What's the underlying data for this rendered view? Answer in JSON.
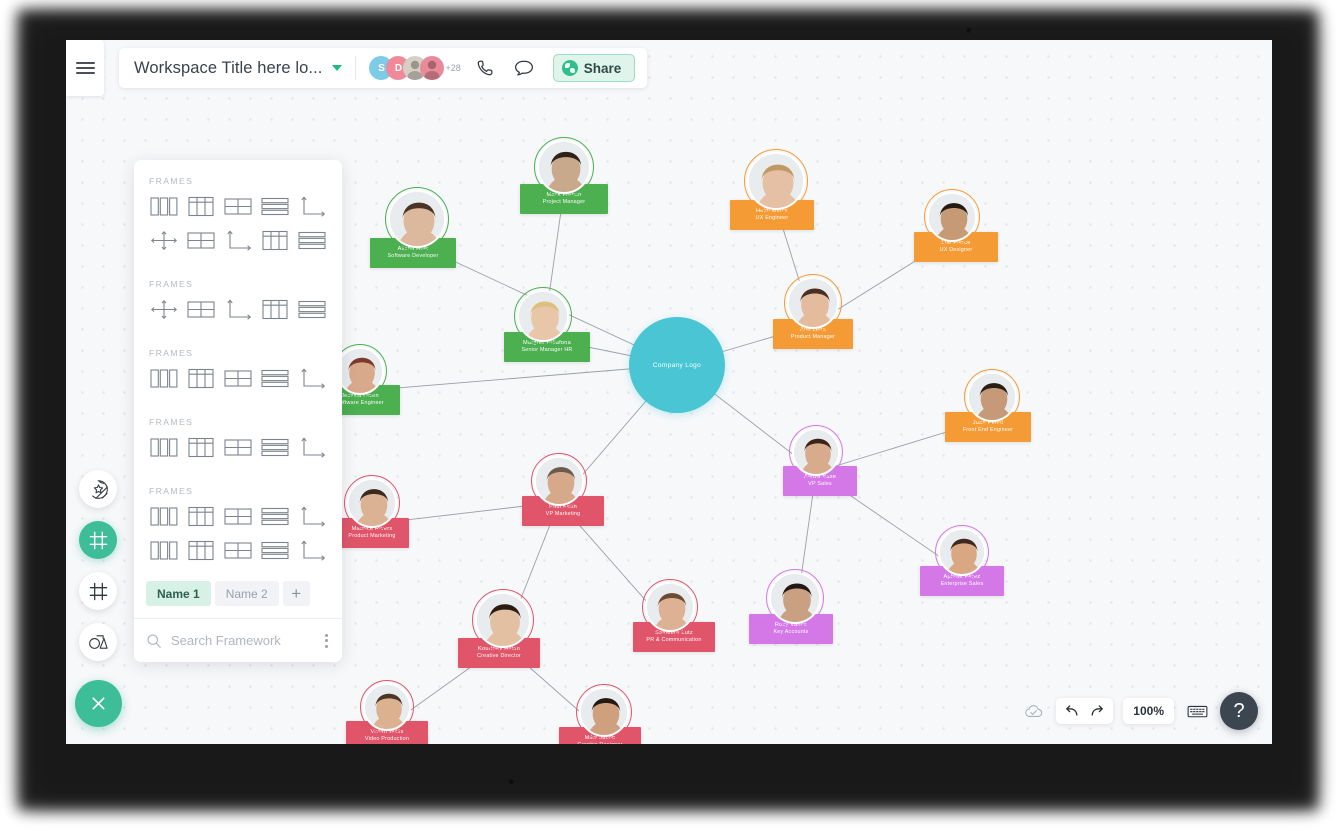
{
  "topbar": {
    "menu_icon": "hamburger-menu-icon",
    "workspace_title": "Workspace Title here lo...",
    "dropdown_icon": "chevron-down-icon",
    "avatars": [
      {
        "label": "S",
        "color": "#7ecbe8",
        "type": "initial"
      },
      {
        "label": "D",
        "color": "#f08a9b",
        "type": "initial"
      },
      {
        "label": "",
        "color": "#d6cfc4",
        "type": "photo"
      },
      {
        "label": "",
        "color": "#e88a9a",
        "type": "photo"
      }
    ],
    "avatar_overflow": "+28",
    "call_icon": "phone-icon",
    "chat_icon": "chat-bubble-icon",
    "share_label": "Share",
    "share_icon": "globe-icon",
    "share_bg": "#dff5ec",
    "share_text_color": "#2f4a48"
  },
  "left_toolbar": [
    {
      "name": "sticker-tool",
      "icon": "sticker-star-icon",
      "active": false
    },
    {
      "name": "frames-tool",
      "icon": "frame-grid-icon",
      "active": true
    },
    {
      "name": "grid-tool",
      "icon": "frame-outline-icon",
      "active": false
    },
    {
      "name": "shapes-tool",
      "icon": "shapes-icon",
      "active": false
    },
    {
      "name": "close-tool",
      "icon": "close-x-icon",
      "active": true
    }
  ],
  "frames_panel": {
    "groups": [
      {
        "label": "FRAMES",
        "rows": [
          [
            "columns-3",
            "grid-header-3col",
            "quad-2x2",
            "stacked-bars",
            "axis-l"
          ],
          [
            "cross-arrows",
            "quad-2x2",
            "axis-l",
            "grid-header-3col",
            "stacked-bars"
          ]
        ]
      },
      {
        "label": "FRAMES",
        "rows": [
          [
            "cross-arrows",
            "quad-2x2",
            "axis-l",
            "grid-header-3col",
            "stacked-bars"
          ]
        ]
      },
      {
        "label": "FRAMES",
        "rows": [
          [
            "columns-3",
            "grid-header-3col",
            "quad-2x2",
            "stacked-bars",
            "axis-l"
          ]
        ]
      },
      {
        "label": "FRAMES",
        "rows": [
          [
            "columns-3",
            "grid-header-3col",
            "quad-2x2",
            "stacked-bars",
            "axis-l"
          ]
        ]
      },
      {
        "label": "FRAMES",
        "rows": [
          [
            "columns-3",
            "grid-header-3col",
            "quad-2x2",
            "stacked-bars",
            "axis-l"
          ],
          [
            "columns-3",
            "grid-header-3col",
            "quad-2x2",
            "stacked-bars",
            "axis-l"
          ]
        ]
      }
    ],
    "tabs": [
      {
        "label": "Name 1",
        "active": true
      },
      {
        "label": "Name 2",
        "active": false
      }
    ],
    "add_tab_label": "+",
    "search_placeholder": "Search Framework",
    "search_icon": "search-icon",
    "more_icon": "more-vertical-icon"
  },
  "chart": {
    "center": {
      "label": "Company   Logo",
      "color": "#49c5d4"
    },
    "colors": {
      "green": "#4caf50",
      "orange": "#f59b35",
      "red": "#e0556a",
      "purple": "#d478e8"
    },
    "nodes": [
      {
        "name": "Mack   French",
        "role": "Project   Manager",
        "color": "green",
        "skin": "#c9a98c",
        "hair": "#2e2118"
      },
      {
        "name": "Alisha   Holk",
        "role": "Software   Developer",
        "color": "green",
        "skin": "#dcb89c",
        "hair": "#4a3426"
      },
      {
        "name": "Margret   Yuliafona",
        "role": "Senior   Manager   HR",
        "color": "green",
        "skin": "#e8c6a8",
        "hair": "#ddc07e"
      },
      {
        "name": "Jessica   Owen",
        "role": "Software   Engineer",
        "color": "green",
        "skin": "#d9a98b",
        "hair": "#7a3b2c"
      },
      {
        "name": "Heidi   Mince",
        "role": "UX   Engineer",
        "color": "orange",
        "skin": "#e6c0a4",
        "hair": "#c09a63"
      },
      {
        "name": "Lue   Pierce",
        "role": "UX   Designer",
        "color": "orange",
        "skin": "#c59a74",
        "hair": "#231a14"
      },
      {
        "name": "Ann   Leda",
        "role": "Product   Manager",
        "color": "orange",
        "skin": "#e5bb9d",
        "hair": "#4b2f20"
      },
      {
        "name": "Juan   Pedid",
        "role": "Front   End   Engineer",
        "color": "orange",
        "skin": "#c69a78",
        "hair": "#2a1d16"
      },
      {
        "name": "Aaliya   Base",
        "role": "VP   Sales",
        "color": "purple",
        "skin": "#d8ab8d",
        "hair": "#3a2418"
      },
      {
        "name": "Aphtae   Perez",
        "role": "Enterprise   Sales",
        "color": "purple",
        "skin": "#d9a883",
        "hair": "#3d2a1c"
      },
      {
        "name": "Roxy   Vance",
        "role": "Key   Accounts",
        "color": "purple",
        "skin": "#caa083",
        "hair": "#241912"
      },
      {
        "name": "Paul   Keith",
        "role": "VP   Marketing",
        "color": "red",
        "skin": "#d7a98b",
        "hair": "#6b5a4d"
      },
      {
        "name": "Maurice   Rivers",
        "role": "Product   Marketing",
        "color": "red",
        "skin": "#dbb294",
        "hair": "#3b2b1e"
      },
      {
        "name": "Kourtney   Hilton",
        "role": "Creative   Director",
        "color": "red",
        "skin": "#e3c0a2",
        "hair": "#2c1d14"
      },
      {
        "name": "Sameera   Lutz",
        "role": "PR   &   Communication",
        "color": "red",
        "skin": "#ddb294",
        "hair": "#6d4b33"
      },
      {
        "name": "Vivian   Willis",
        "role": "Video   Production",
        "color": "red",
        "skin": "#dbb190",
        "hair": "#4a3726"
      },
      {
        "name": "Mike   Jacob",
        "role": "Graphic   Designer",
        "color": "red",
        "skin": "#cfa07e",
        "hair": "#231812"
      }
    ]
  },
  "bottombar": {
    "cloud_icon": "cloud-check-icon",
    "undo_icon": "undo-arrow-icon",
    "redo_icon": "redo-arrow-icon",
    "zoom_level": "100%",
    "keyboard_icon": "keyboard-icon",
    "help_label": "?",
    "help_icon": "help-question-icon"
  }
}
